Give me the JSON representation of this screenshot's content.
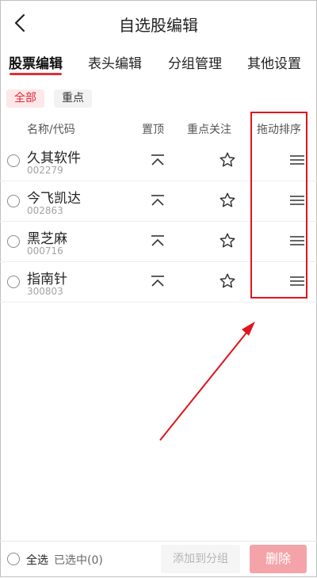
{
  "header": {
    "title": "自选股编辑",
    "back_icon": "chevron-left-icon"
  },
  "tabs": [
    {
      "label": "股票编辑",
      "active": true
    },
    {
      "label": "表头编辑",
      "active": false
    },
    {
      "label": "分组管理",
      "active": false
    },
    {
      "label": "其他设置",
      "active": false
    }
  ],
  "filters": [
    {
      "label": "全部",
      "active": true
    },
    {
      "label": "重点",
      "active": false
    }
  ],
  "columns": {
    "name": "名称/代码",
    "pin": "置顶",
    "focus": "重点关注",
    "drag": "拖动排序"
  },
  "stocks": [
    {
      "name": "久其软件",
      "code": "002279"
    },
    {
      "name": "今飞凯达",
      "code": "002863"
    },
    {
      "name": "黑芝麻",
      "code": "000716"
    },
    {
      "name": "指南针",
      "code": "300803"
    }
  ],
  "footer": {
    "select_all": "全选",
    "selected_count": "已选中(0)",
    "add_to_group": "添加到分组",
    "delete": "删除"
  },
  "colors": {
    "accent": "#e0303a",
    "annotation": "#e0141c",
    "delete_bg": "#f4a4a9"
  },
  "icons": [
    "chevron-left-icon",
    "radio-icon",
    "pin-top-icon",
    "star-icon",
    "drag-handle-icon",
    "arrow-annotation-icon"
  ]
}
